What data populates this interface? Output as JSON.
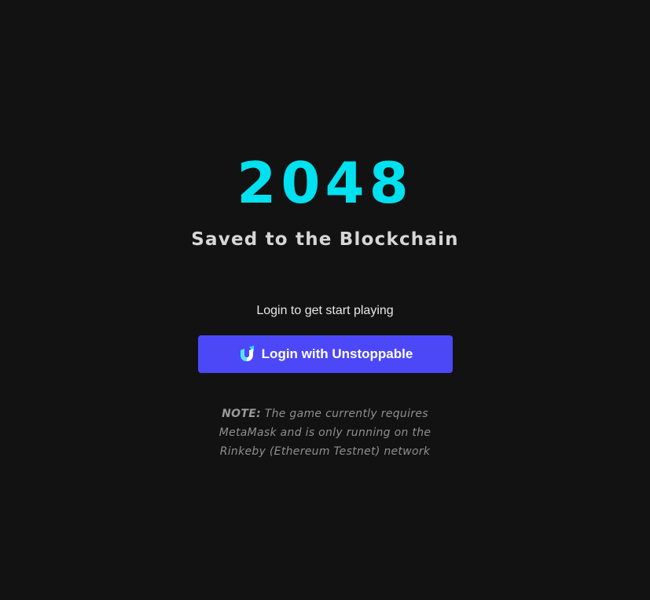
{
  "header": {
    "title": "2048",
    "subtitle": "Saved to the Blockchain"
  },
  "login": {
    "prompt": "Login to get start playing",
    "button_label": "Login with Unstoppable",
    "button_icon": "unstoppable-domains-icon"
  },
  "note": {
    "label": "NOTE:",
    "line1": " The game currently requires",
    "line2": "MetaMask and is only running on the",
    "line3": "Rinkeby (Ethereum Testnet) network"
  },
  "colors": {
    "background": "#121212",
    "title": "#00e1f0",
    "button": "#4c47f7"
  }
}
